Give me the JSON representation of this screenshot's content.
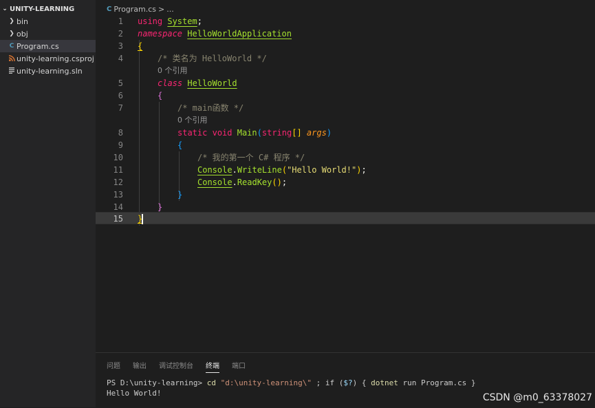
{
  "sidebar": {
    "title": "UNITY-LEARNING",
    "items": [
      {
        "label": "bin",
        "kind": "folder"
      },
      {
        "label": "obj",
        "kind": "folder"
      },
      {
        "label": "Program.cs",
        "kind": "csharp"
      },
      {
        "label": "unity-learning.csproj",
        "kind": "rss"
      },
      {
        "label": "unity-learning.sln",
        "kind": "file"
      }
    ]
  },
  "editor": {
    "breadcrumb": {
      "file": "Program.cs",
      "sep": ">",
      "more": "..."
    },
    "lines": [
      "1",
      "2",
      "3",
      "4",
      "5",
      "6",
      "7",
      "8",
      "9",
      "10",
      "11",
      "12",
      "13",
      "14",
      "15"
    ],
    "code": {
      "l1_kw": "using",
      "l1_ns": "System",
      "l1_semi": ";",
      "l2_kw": "namespace",
      "l2_name": "HelloWorldApplication",
      "l3": "{",
      "l4_comment": "/* 类名为 HelloWorld */",
      "lens1": "0 个引用",
      "l5_kw": "class",
      "l5_name": "HelloWorld",
      "l6": "{",
      "l7_comment": "/* main函数 */",
      "lens2": "0 个引用",
      "l8_static": "static",
      "l8_void": "void",
      "l8_main": "Main",
      "l8_lp": "(",
      "l8_type": "string",
      "l8_arr": "[]",
      "l8_arg": "args",
      "l8_rp": ")",
      "l9": "{",
      "l10_comment": "/* 我的第一个 C# 程序 */",
      "l11_console": "Console",
      "l11_dot": ".",
      "l11_method": "WriteLine",
      "l11_lp": "(",
      "l11_str": "\"Hello World!\"",
      "l11_rp": ")",
      "l11_semi": ";",
      "l12_console": "Console",
      "l12_dot": ".",
      "l12_method": "ReadKey",
      "l12_parens": "()",
      "l12_semi": ";",
      "l13": "}",
      "l14": "}",
      "l15": "}"
    }
  },
  "panel": {
    "tabs": [
      "问题",
      "输出",
      "调试控制台",
      "终端",
      "端口"
    ],
    "active_tab": "终端",
    "terminal": {
      "prompt": "PS D:\\unity-learning>",
      "cmd1": "cd",
      "arg1": "\"d:\\unity-learning\\\"",
      "rest1": " ; if (",
      "var": "$?",
      "rest2": ") { ",
      "cmd2": "dotnet",
      "rest3": " run Program.cs }",
      "output": "Hello World!"
    }
  },
  "watermark": "CSDN @m0_63378027",
  "colors": {
    "background": "#1e1e1e",
    "sidebar": "#252526",
    "keyword": "#f92672",
    "type": "#a6e22e",
    "string": "#e6db74",
    "comment": "#88846f"
  }
}
